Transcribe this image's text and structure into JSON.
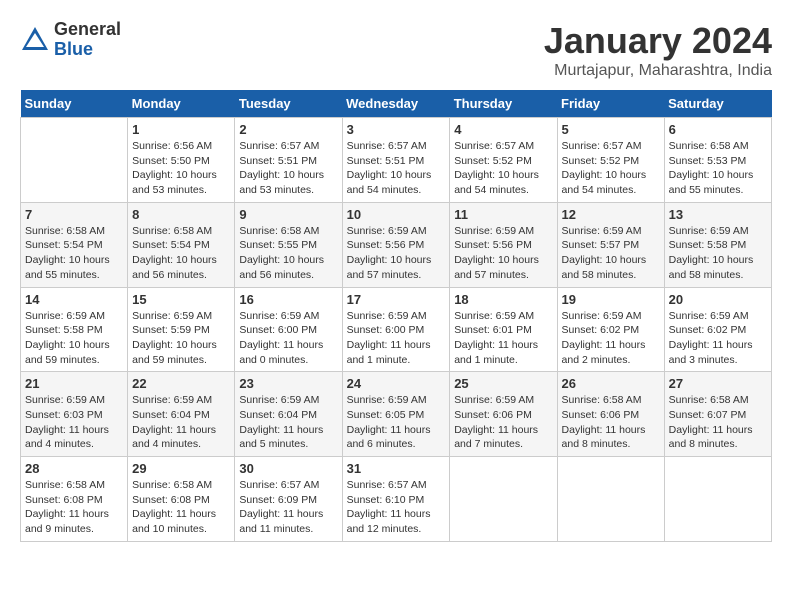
{
  "logo": {
    "general": "General",
    "blue": "Blue"
  },
  "title": "January 2024",
  "subtitle": "Murtajapur, Maharashtra, India",
  "weekdays": [
    "Sunday",
    "Monday",
    "Tuesday",
    "Wednesday",
    "Thursday",
    "Friday",
    "Saturday"
  ],
  "weeks": [
    [
      {
        "day": "",
        "info": ""
      },
      {
        "day": "1",
        "info": "Sunrise: 6:56 AM\nSunset: 5:50 PM\nDaylight: 10 hours\nand 53 minutes."
      },
      {
        "day": "2",
        "info": "Sunrise: 6:57 AM\nSunset: 5:51 PM\nDaylight: 10 hours\nand 53 minutes."
      },
      {
        "day": "3",
        "info": "Sunrise: 6:57 AM\nSunset: 5:51 PM\nDaylight: 10 hours\nand 54 minutes."
      },
      {
        "day": "4",
        "info": "Sunrise: 6:57 AM\nSunset: 5:52 PM\nDaylight: 10 hours\nand 54 minutes."
      },
      {
        "day": "5",
        "info": "Sunrise: 6:57 AM\nSunset: 5:52 PM\nDaylight: 10 hours\nand 54 minutes."
      },
      {
        "day": "6",
        "info": "Sunrise: 6:58 AM\nSunset: 5:53 PM\nDaylight: 10 hours\nand 55 minutes."
      }
    ],
    [
      {
        "day": "7",
        "info": "Sunrise: 6:58 AM\nSunset: 5:54 PM\nDaylight: 10 hours\nand 55 minutes."
      },
      {
        "day": "8",
        "info": "Sunrise: 6:58 AM\nSunset: 5:54 PM\nDaylight: 10 hours\nand 56 minutes."
      },
      {
        "day": "9",
        "info": "Sunrise: 6:58 AM\nSunset: 5:55 PM\nDaylight: 10 hours\nand 56 minutes."
      },
      {
        "day": "10",
        "info": "Sunrise: 6:59 AM\nSunset: 5:56 PM\nDaylight: 10 hours\nand 57 minutes."
      },
      {
        "day": "11",
        "info": "Sunrise: 6:59 AM\nSunset: 5:56 PM\nDaylight: 10 hours\nand 57 minutes."
      },
      {
        "day": "12",
        "info": "Sunrise: 6:59 AM\nSunset: 5:57 PM\nDaylight: 10 hours\nand 58 minutes."
      },
      {
        "day": "13",
        "info": "Sunrise: 6:59 AM\nSunset: 5:58 PM\nDaylight: 10 hours\nand 58 minutes."
      }
    ],
    [
      {
        "day": "14",
        "info": "Sunrise: 6:59 AM\nSunset: 5:58 PM\nDaylight: 10 hours\nand 59 minutes."
      },
      {
        "day": "15",
        "info": "Sunrise: 6:59 AM\nSunset: 5:59 PM\nDaylight: 10 hours\nand 59 minutes."
      },
      {
        "day": "16",
        "info": "Sunrise: 6:59 AM\nSunset: 6:00 PM\nDaylight: 11 hours\nand 0 minutes."
      },
      {
        "day": "17",
        "info": "Sunrise: 6:59 AM\nSunset: 6:00 PM\nDaylight: 11 hours\nand 1 minute."
      },
      {
        "day": "18",
        "info": "Sunrise: 6:59 AM\nSunset: 6:01 PM\nDaylight: 11 hours\nand 1 minute."
      },
      {
        "day": "19",
        "info": "Sunrise: 6:59 AM\nSunset: 6:02 PM\nDaylight: 11 hours\nand 2 minutes."
      },
      {
        "day": "20",
        "info": "Sunrise: 6:59 AM\nSunset: 6:02 PM\nDaylight: 11 hours\nand 3 minutes."
      }
    ],
    [
      {
        "day": "21",
        "info": "Sunrise: 6:59 AM\nSunset: 6:03 PM\nDaylight: 11 hours\nand 4 minutes."
      },
      {
        "day": "22",
        "info": "Sunrise: 6:59 AM\nSunset: 6:04 PM\nDaylight: 11 hours\nand 4 minutes."
      },
      {
        "day": "23",
        "info": "Sunrise: 6:59 AM\nSunset: 6:04 PM\nDaylight: 11 hours\nand 5 minutes."
      },
      {
        "day": "24",
        "info": "Sunrise: 6:59 AM\nSunset: 6:05 PM\nDaylight: 11 hours\nand 6 minutes."
      },
      {
        "day": "25",
        "info": "Sunrise: 6:59 AM\nSunset: 6:06 PM\nDaylight: 11 hours\nand 7 minutes."
      },
      {
        "day": "26",
        "info": "Sunrise: 6:58 AM\nSunset: 6:06 PM\nDaylight: 11 hours\nand 8 minutes."
      },
      {
        "day": "27",
        "info": "Sunrise: 6:58 AM\nSunset: 6:07 PM\nDaylight: 11 hours\nand 8 minutes."
      }
    ],
    [
      {
        "day": "28",
        "info": "Sunrise: 6:58 AM\nSunset: 6:08 PM\nDaylight: 11 hours\nand 9 minutes."
      },
      {
        "day": "29",
        "info": "Sunrise: 6:58 AM\nSunset: 6:08 PM\nDaylight: 11 hours\nand 10 minutes."
      },
      {
        "day": "30",
        "info": "Sunrise: 6:57 AM\nSunset: 6:09 PM\nDaylight: 11 hours\nand 11 minutes."
      },
      {
        "day": "31",
        "info": "Sunrise: 6:57 AM\nSunset: 6:10 PM\nDaylight: 11 hours\nand 12 minutes."
      },
      {
        "day": "",
        "info": ""
      },
      {
        "day": "",
        "info": ""
      },
      {
        "day": "",
        "info": ""
      }
    ]
  ]
}
